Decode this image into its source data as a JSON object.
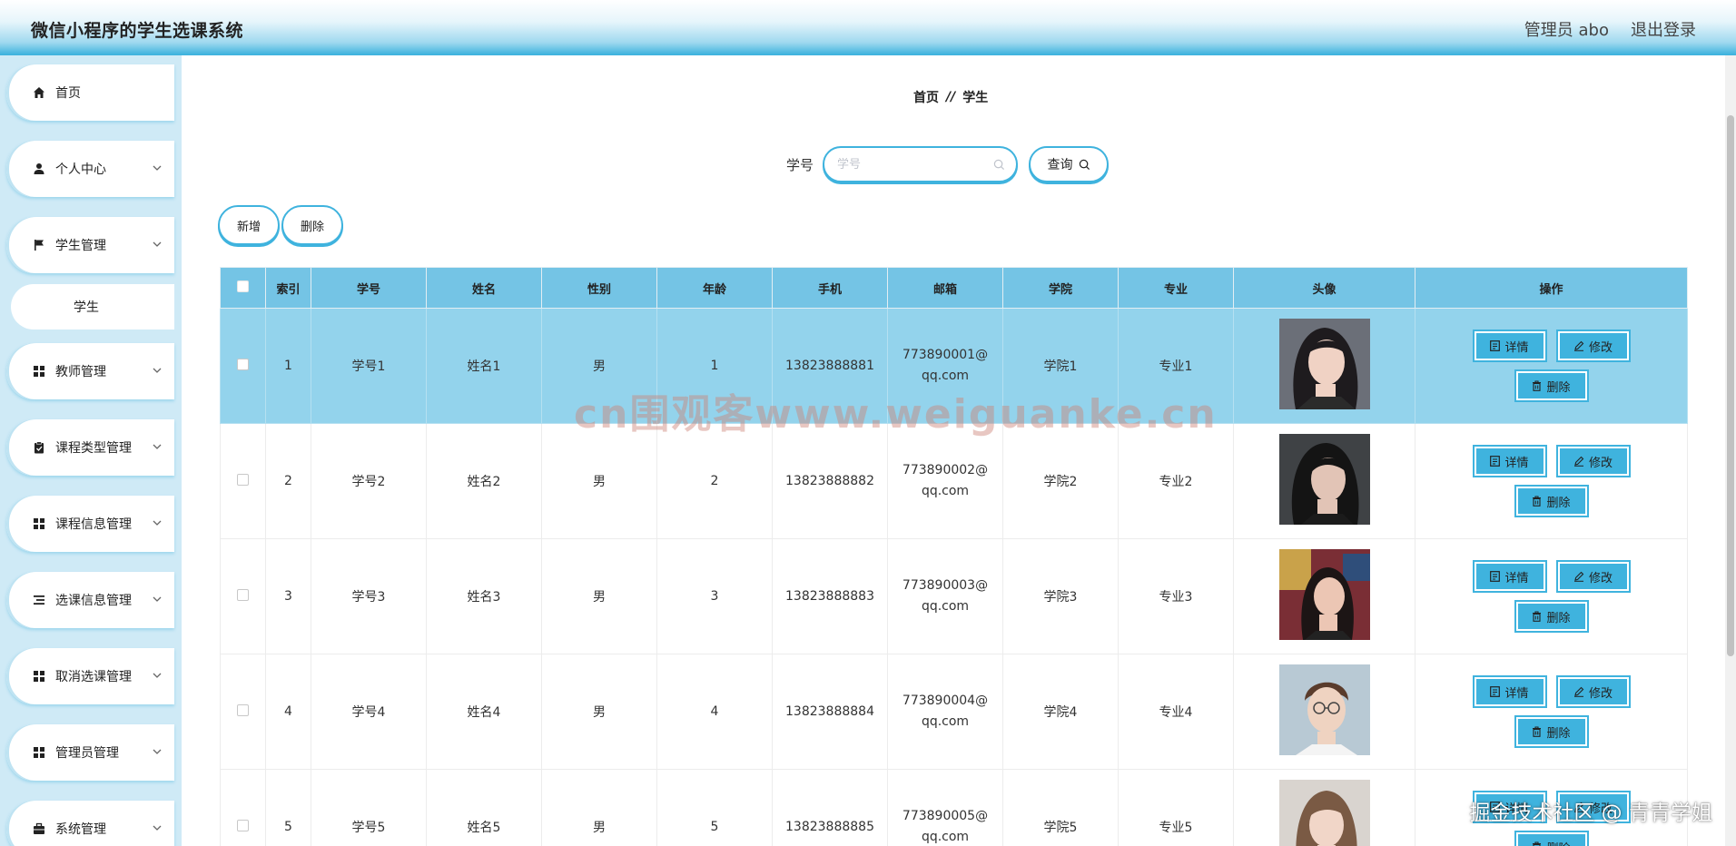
{
  "header": {
    "app_title": "微信小程序的学生选课系统",
    "user_label": "管理员 abo",
    "logout_label": "退出登录"
  },
  "sidebar": {
    "items": [
      {
        "label": "首页",
        "icon": "home-icon"
      },
      {
        "label": "个人中心",
        "icon": "user-icon"
      },
      {
        "label": "学生管理",
        "icon": "flag-icon"
      },
      {
        "label": "学生",
        "icon": ""
      },
      {
        "label": "教师管理",
        "icon": "grid-icon"
      },
      {
        "label": "课程类型管理",
        "icon": "clipboard-icon"
      },
      {
        "label": "课程信息管理",
        "icon": "grid-icon"
      },
      {
        "label": "选课信息管理",
        "icon": "list-icon"
      },
      {
        "label": "取消选课管理",
        "icon": "grid-icon"
      },
      {
        "label": "管理员管理",
        "icon": "grid-icon"
      },
      {
        "label": "系统管理",
        "icon": "briefcase-icon"
      }
    ]
  },
  "breadcrumb": {
    "home": "首页",
    "separator": "//",
    "current": "学生"
  },
  "search": {
    "label": "学号",
    "placeholder": "学号",
    "query_label": "查询"
  },
  "actions": {
    "add_label": "新增",
    "delete_label": "删除"
  },
  "table": {
    "columns": [
      "索引",
      "学号",
      "姓名",
      "性别",
      "年龄",
      "手机",
      "邮箱",
      "学院",
      "专业",
      "头像",
      "操作"
    ],
    "rows": [
      {
        "index": "1",
        "student_no": "学号1",
        "name": "姓名1",
        "gender": "男",
        "age": "1",
        "phone": "13823888881",
        "email": "773890001@qq.com",
        "college": "学院1",
        "major": "专业1"
      },
      {
        "index": "2",
        "student_no": "学号2",
        "name": "姓名2",
        "gender": "男",
        "age": "2",
        "phone": "13823888882",
        "email": "773890002@qq.com",
        "college": "学院2",
        "major": "专业2"
      },
      {
        "index": "3",
        "student_no": "学号3",
        "name": "姓名3",
        "gender": "男",
        "age": "3",
        "phone": "13823888883",
        "email": "773890003@qq.com",
        "college": "学院3",
        "major": "专业3"
      },
      {
        "index": "4",
        "student_no": "学号4",
        "name": "姓名4",
        "gender": "男",
        "age": "4",
        "phone": "13823888884",
        "email": "773890004@qq.com",
        "college": "学院4",
        "major": "专业4"
      },
      {
        "index": "5",
        "student_no": "学号5",
        "name": "姓名5",
        "gender": "男",
        "age": "5",
        "phone": "13823888885",
        "email": "773890005@qq.com",
        "college": "学院5",
        "major": "专业5"
      }
    ],
    "op_labels": {
      "detail": "详情",
      "edit": "修改",
      "delete": "删除"
    }
  },
  "watermarks": {
    "center": "cn围观客www.weiguanke.cn",
    "corner": "掘金技术社区 @ 青青学姐"
  },
  "colors": {
    "accent": "#3fb3de",
    "header_row": "#74c4e5",
    "selected_row": "#93d3ec",
    "sidebar_bg": "#cfeaf6"
  }
}
